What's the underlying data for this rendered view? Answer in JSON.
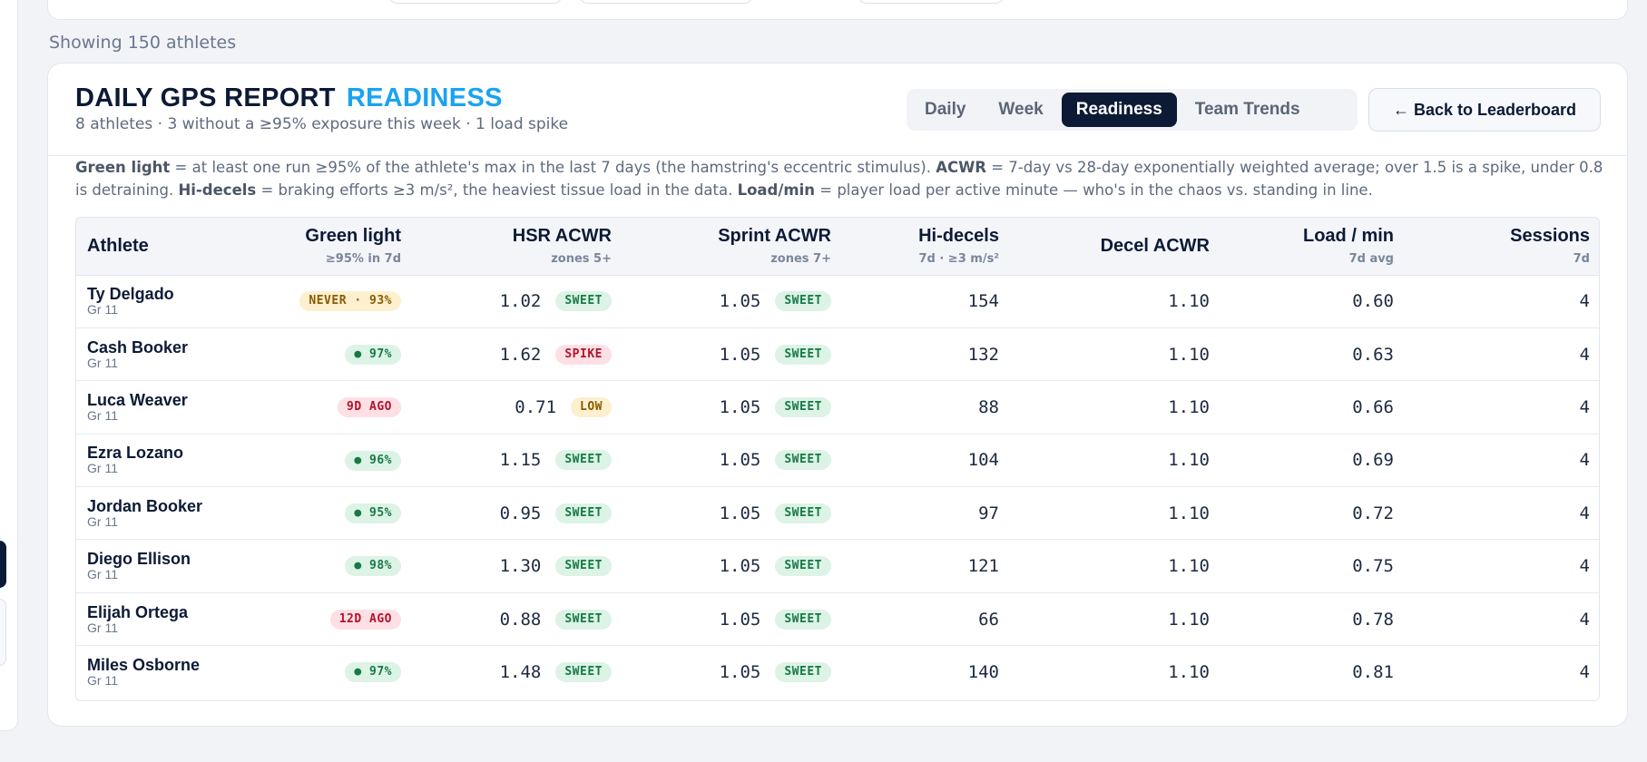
{
  "showing_text": "Showing 150 athletes",
  "report": {
    "title": "DAILY GPS REPORT",
    "title_accent": "READINESS",
    "subtitle": "8 athletes · 3 without a ≥95% exposure this week · 1 load spike"
  },
  "tabs": [
    {
      "label": "Daily",
      "active": false
    },
    {
      "label": "Week",
      "active": false
    },
    {
      "label": "Readiness",
      "active": true
    },
    {
      "label": "Team Trends",
      "active": false
    }
  ],
  "back_button": "← Back to Leaderboard",
  "legend": {
    "green_light_term": "Green light",
    "green_light_def": " = at least one run ≥95% of the athlete's max in the last 7 days (the hamstring's eccentric stimulus). ",
    "acwr_term": "ACWR",
    "acwr_def": " = 7-day vs 28-day exponentially weighted average; over 1.5 is a spike, under 0.8 is detraining. ",
    "hidecels_term": "Hi-decels",
    "hidecels_def": " = braking efforts ≥3 m/s², the heaviest tissue load in the data. ",
    "loadmin_term": "Load/min",
    "loadmin_def": " = player load per active minute — who's in the chaos vs. standing in line."
  },
  "columns": [
    {
      "label": "Athlete",
      "sub": ""
    },
    {
      "label": "Green light",
      "sub": "≥95% in 7d"
    },
    {
      "label": "HSR ACWR",
      "sub": "zones 5+"
    },
    {
      "label": "Sprint ACWR",
      "sub": "zones 7+"
    },
    {
      "label": "Hi-decels",
      "sub": "7d · ≥3 m/s²"
    },
    {
      "label": "Decel ACWR",
      "sub": ""
    },
    {
      "label": "Load / min",
      "sub": "7d avg"
    },
    {
      "label": "Sessions",
      "sub": "7d"
    }
  ],
  "rows": [
    {
      "name": "Ty Delgado",
      "grade": "Gr 11",
      "green": "NEVER · 93%",
      "green_tone": "amber",
      "hsr": "1.02",
      "hsr_tag": "SWEET",
      "hsr_tone": "green",
      "sprint": "1.05",
      "sprint_tag": "SWEET",
      "hidecels": "154",
      "decel": "1.10",
      "load": "0.60",
      "sessions": "4"
    },
    {
      "name": "Cash Booker",
      "grade": "Gr 11",
      "green": "● 97%",
      "green_tone": "green",
      "hsr": "1.62",
      "hsr_tag": "SPIKE",
      "hsr_tone": "red",
      "sprint": "1.05",
      "sprint_tag": "SWEET",
      "hidecels": "132",
      "decel": "1.10",
      "load": "0.63",
      "sessions": "4"
    },
    {
      "name": "Luca Weaver",
      "grade": "Gr 11",
      "green": "9D AGO",
      "green_tone": "red",
      "hsr": "0.71",
      "hsr_tag": "LOW",
      "hsr_tone": "amber",
      "sprint": "1.05",
      "sprint_tag": "SWEET",
      "hidecels": "88",
      "decel": "1.10",
      "load": "0.66",
      "sessions": "4"
    },
    {
      "name": "Ezra Lozano",
      "grade": "Gr 11",
      "green": "● 96%",
      "green_tone": "green",
      "hsr": "1.15",
      "hsr_tag": "SWEET",
      "hsr_tone": "green",
      "sprint": "1.05",
      "sprint_tag": "SWEET",
      "hidecels": "104",
      "decel": "1.10",
      "load": "0.69",
      "sessions": "4"
    },
    {
      "name": "Jordan Booker",
      "grade": "Gr 11",
      "green": "● 95%",
      "green_tone": "green",
      "hsr": "0.95",
      "hsr_tag": "SWEET",
      "hsr_tone": "green",
      "sprint": "1.05",
      "sprint_tag": "SWEET",
      "hidecels": "97",
      "decel": "1.10",
      "load": "0.72",
      "sessions": "4"
    },
    {
      "name": "Diego Ellison",
      "grade": "Gr 11",
      "green": "● 98%",
      "green_tone": "green",
      "hsr": "1.30",
      "hsr_tag": "SWEET",
      "hsr_tone": "green",
      "sprint": "1.05",
      "sprint_tag": "SWEET",
      "hidecels": "121",
      "decel": "1.10",
      "load": "0.75",
      "sessions": "4"
    },
    {
      "name": "Elijah Ortega",
      "grade": "Gr 11",
      "green": "12D AGO",
      "green_tone": "red",
      "hsr": "0.88",
      "hsr_tag": "SWEET",
      "hsr_tone": "green",
      "sprint": "1.05",
      "sprint_tag": "SWEET",
      "hidecels": "66",
      "decel": "1.10",
      "load": "0.78",
      "sessions": "4"
    },
    {
      "name": "Miles Osborne",
      "grade": "Gr 11",
      "green": "● 97%",
      "green_tone": "green",
      "hsr": "1.48",
      "hsr_tag": "SWEET",
      "hsr_tone": "green",
      "sprint": "1.05",
      "sprint_tag": "SWEET",
      "hidecels": "140",
      "decel": "1.10",
      "load": "0.81",
      "sessions": "4"
    }
  ],
  "colors": {
    "accent": "#1aa3f0",
    "navy": "#0c1a35",
    "pill_green": "#167a45",
    "pill_red": "#b3122c",
    "pill_amber": "#8a5a00"
  }
}
